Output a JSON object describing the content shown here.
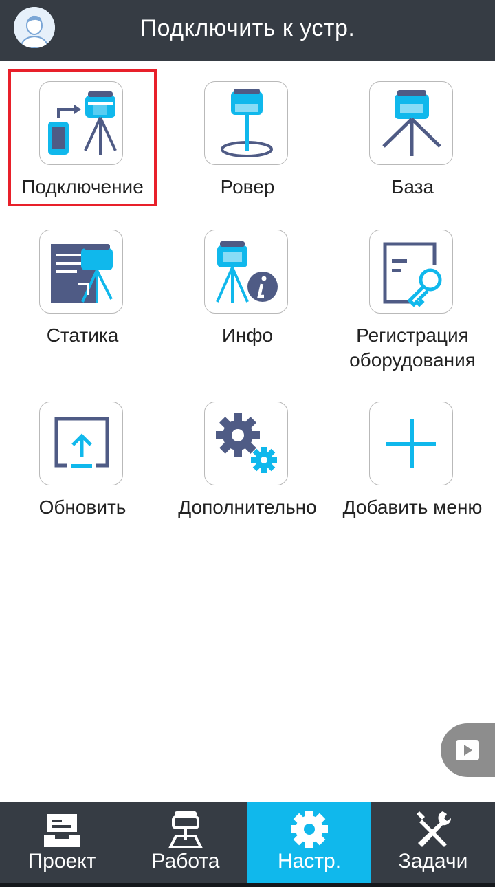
{
  "header": {
    "title": "Подключить к устр."
  },
  "menu": [
    {
      "label": "Подключение",
      "icon": "connection-icon"
    },
    {
      "label": "Ровер",
      "icon": "rover-icon"
    },
    {
      "label": "База",
      "icon": "base-icon"
    },
    {
      "label": "Статика",
      "icon": "static-icon"
    },
    {
      "label": "Инфо",
      "icon": "info-icon"
    },
    {
      "label": "Регистрация оборудования",
      "label_line1": "Регистрация",
      "label_line2": "оборудования",
      "icon": "registration-key-icon"
    },
    {
      "label": "Обновить",
      "icon": "update-icon"
    },
    {
      "label": "Дополнительно",
      "icon": "gears-icon"
    },
    {
      "label": "Добавить меню",
      "icon": "plus-icon"
    }
  ],
  "tabs": [
    {
      "label": "Проект",
      "icon": "inbox-icon",
      "active": false
    },
    {
      "label": "Работа",
      "icon": "survey-icon",
      "active": false
    },
    {
      "label": "Настр.",
      "icon": "gear-icon",
      "active": true
    },
    {
      "label": "Задачи",
      "icon": "tools-icon",
      "active": false
    }
  ],
  "colors": {
    "header_bg": "#363c44",
    "accent": "#10b8ec",
    "icon_dark": "#4f5b85",
    "highlight": "#e8202a"
  }
}
